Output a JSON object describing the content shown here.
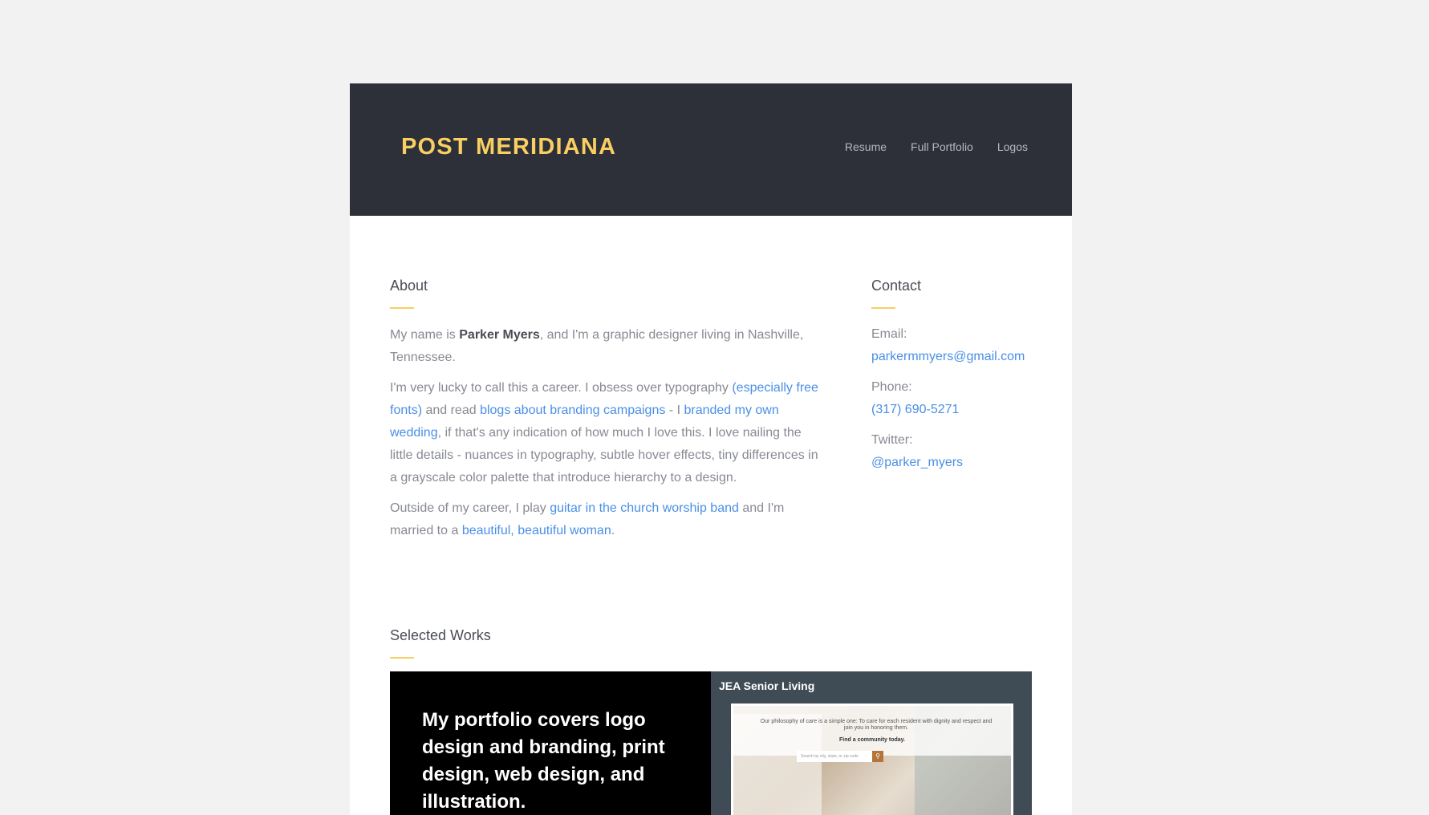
{
  "header": {
    "brand": "POST MERIDIANA",
    "nav": [
      "Resume",
      "Full Portfolio",
      "Logos"
    ]
  },
  "about": {
    "title": "About",
    "p1_pre": "My name is ",
    "p1_name": "Parker Myers",
    "p1_post": ", and I'm a graphic designer living in Nashville, Tennessee.",
    "p2_a": "I'm very lucky to call this a career. I obsess over typography ",
    "p2_link1": "(especially free fonts)",
    "p2_b": " and read ",
    "p2_link2": "blogs about branding campaigns",
    "p2_c": " - I ",
    "p2_link3": "branded my own wedding",
    "p2_d": ", if that's any indication of how much I love this. I love nailing the little details - nuances in typography, subtle hover effects, tiny differences in a grayscale color palette that introduce hierarchy to a design.",
    "p3_a": "Outside of my career, I play ",
    "p3_link1": "guitar in the church worship band",
    "p3_b": " and I'm married to a ",
    "p3_link2": "beautiful, beautiful woman",
    "p3_c": "."
  },
  "contact": {
    "title": "Contact",
    "email_label": "Email:",
    "email": "parkermmyers@gmail.com",
    "phone_label": "Phone:",
    "phone": "(317) 690-5271",
    "twitter_label": "Twitter:",
    "twitter": "@parker_myers"
  },
  "works": {
    "title": "Selected Works",
    "intro": "My portfolio covers logo design and branding, print design, web design, and illustration.",
    "items": [
      {
        "title": "JEA Senior Living",
        "thumb_tagline": "Our philosophy of care is a simple one: To care for each resident with dignity and respect and join you in honoring them.",
        "thumb_cta": "Find a community today.",
        "thumb_search": "Search by city, state, or zip code"
      }
    ]
  },
  "colors": {
    "accent": "#f9cf62",
    "header_bg": "#2d3039",
    "link": "#4a8fe7",
    "body_text": "#878a93"
  }
}
